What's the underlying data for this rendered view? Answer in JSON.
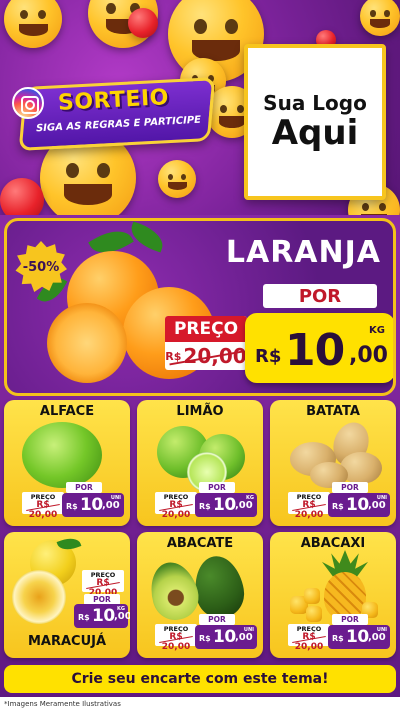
{
  "header": {
    "sorteio_title": "SORTEIO",
    "sorteio_subtitle": "SIGA AS REGRAS E PARTICIPE",
    "logo_line1": "Sua Logo",
    "logo_line2": "Aqui"
  },
  "hero": {
    "product": "LARANJA",
    "discount": "-50%",
    "por_label": "POR",
    "preco_label": "PREÇO",
    "old_currency": "R$",
    "old_price": "20,00",
    "currency": "R$",
    "price_int": "10",
    "price_dec": ",00",
    "unit": "KG"
  },
  "products": [
    {
      "name": "ALFACE",
      "preco_label": "PREÇO",
      "old_price": "R$ 20,00",
      "por_label": "POR",
      "currency": "R$",
      "price_int": "10",
      "price_dec": ",00",
      "unit": "UNI"
    },
    {
      "name": "LIMÃO",
      "preco_label": "PREÇO",
      "old_price": "R$ 20,00",
      "por_label": "POR",
      "currency": "R$",
      "price_int": "10",
      "price_dec": ",00",
      "unit": "KG"
    },
    {
      "name": "BATATA",
      "preco_label": "PREÇO",
      "old_price": "R$ 20,00",
      "por_label": "POR",
      "currency": "R$",
      "price_int": "10",
      "price_dec": ",00",
      "unit": "UNI"
    },
    {
      "name": "MARACUJÁ",
      "preco_label": "PREÇO",
      "old_price": "R$ 20,00",
      "por_label": "POR",
      "currency": "R$",
      "price_int": "10",
      "price_dec": ",00",
      "unit": "KG"
    },
    {
      "name": "ABACATE",
      "preco_label": "PREÇO",
      "old_price": "R$ 20,00",
      "por_label": "POR",
      "currency": "R$",
      "price_int": "10",
      "price_dec": ",00",
      "unit": "UNI"
    },
    {
      "name": "ABACAXI",
      "preco_label": "PREÇO",
      "old_price": "R$ 20,00",
      "por_label": "POR",
      "currency": "R$",
      "price_int": "10",
      "price_dec": ",00",
      "unit": "UNI"
    }
  ],
  "cta": "Crie seu encarte com este tema!",
  "footnote": "*Imagens Meramente Ilustrativas",
  "colors": {
    "purple": "#6a1c8f",
    "yellow": "#ffe100",
    "red": "#c0192a"
  },
  "icons": [
    "instagram-icon",
    "emoji-icon",
    "heart-balloon-icon"
  ]
}
